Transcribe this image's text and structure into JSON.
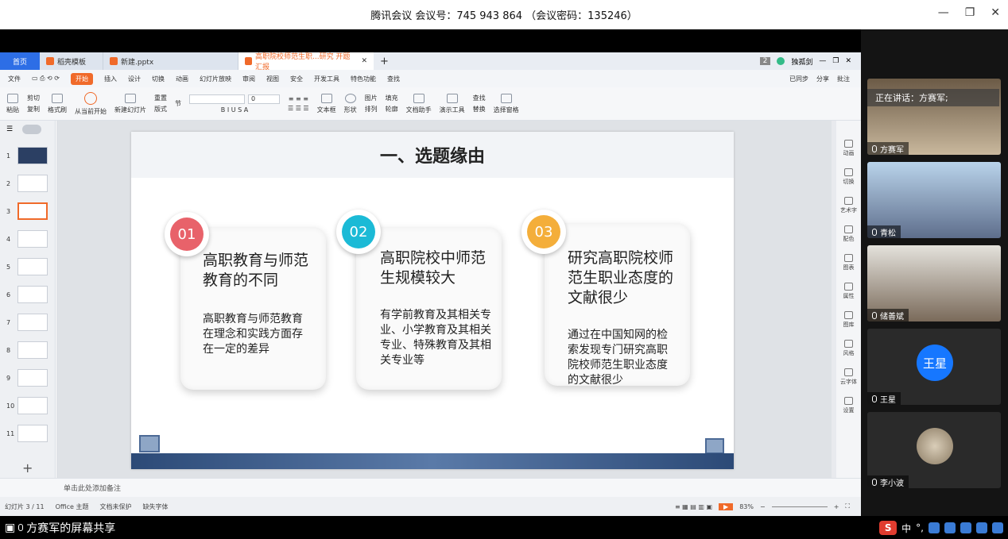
{
  "window": {
    "title": "腾讯会议 会议号：745 943 864 （会议密码：135246）"
  },
  "wps": {
    "tabs": [
      {
        "label": "首页"
      },
      {
        "label": "稻壳模板"
      },
      {
        "label": "新建.pptx"
      },
      {
        "label": "高职院校师范生职...研究 开题汇报"
      }
    ],
    "badge": "2",
    "user": "独孤剑",
    "menu": [
      "文件",
      "开始",
      "插入",
      "设计",
      "切换",
      "动画",
      "幻灯片放映",
      "审阅",
      "视图",
      "安全",
      "开发工具",
      "特色功能",
      "查找"
    ],
    "menu_right": [
      "已同步",
      "分享",
      "批注"
    ],
    "ribbon": [
      "粘贴",
      "剪切",
      "复制",
      "格式刷",
      "从当前开始",
      "新建幻灯片",
      "版式",
      "节",
      "重置",
      "文本框",
      "形状",
      "排列",
      "图片",
      "填充",
      "轮廓",
      "文档助手",
      "演示工具",
      "查找",
      "替换",
      "选择窗格"
    ],
    "font_size": "0",
    "slide_numbers": [
      "1",
      "2",
      "3",
      "4",
      "5",
      "6",
      "7",
      "8",
      "9",
      "10",
      "11"
    ],
    "right_panel": [
      "动画",
      "切换",
      "艺术字",
      "配色",
      "图表",
      "属性",
      "图库",
      "风格",
      "云字体",
      "设置"
    ],
    "notes_placeholder": "单击此处添加备注",
    "status": {
      "slide": "幻灯片 3 / 11",
      "theme": "Office 主题",
      "protect": "文档未保护",
      "font": "缺失字体",
      "zoom": "83%"
    }
  },
  "slide": {
    "title": "一、选题缘由",
    "cards": [
      {
        "num": "01",
        "color": "#e8626a",
        "title": "高职教育与师范教育的不同",
        "body": "高职教育与师范教育在理念和实践方面存在一定的差异"
      },
      {
        "num": "02",
        "color": "#1bbad6",
        "title": "高职院校中师范生规模较大",
        "body": "有学前教育及其相关专业、小学教育及其相关专业、特殊教育及其相关专业等"
      },
      {
        "num": "03",
        "color": "#f4ae3a",
        "title": "研究高职院校师范生职业态度的文献很少",
        "body": "通过在中国知网的检索发现专门研究高职院校师范生职业态度的文献很少"
      }
    ]
  },
  "meeting": {
    "speaking": "正在讲话：方赛军;",
    "participants": [
      {
        "name": "方赛军"
      },
      {
        "name": "青松"
      },
      {
        "name": "储善斌"
      },
      {
        "name": "王星",
        "avatar": "王星"
      },
      {
        "name": "李小波"
      }
    ],
    "share_label": "方赛军的屏幕共享",
    "ime": [
      "S",
      "中",
      "°,"
    ]
  }
}
